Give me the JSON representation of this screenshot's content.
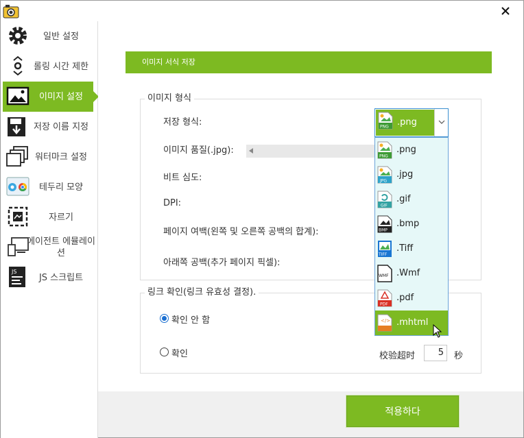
{
  "sidebar": {
    "items": [
      {
        "label": "일반 설정",
        "icon": "gear-icon"
      },
      {
        "label": "롤링 시간 제한",
        "icon": "scroll-icon"
      },
      {
        "label": "이미지 설정",
        "icon": "image-icon",
        "active": true
      },
      {
        "label": "저장 이름 지정",
        "icon": "save-icon"
      },
      {
        "label": "워터마크 설정",
        "icon": "watermark-icon"
      },
      {
        "label": "테두리 모양",
        "icon": "browser-icon"
      },
      {
        "label": "자르기",
        "icon": "crop-icon"
      },
      {
        "label": "에이전트 에뮬레이션",
        "icon": "devices-icon"
      },
      {
        "label": "JS 스크립트",
        "icon": "js-icon"
      }
    ]
  },
  "main": {
    "header": "이미지 서식 저장",
    "image_format_group": {
      "title": "이미지 형식",
      "save_format_label": "저장 형식:",
      "quality_label": "이미지 품질(.jpg):",
      "bit_depth_label": "비트 심도:",
      "dpi_label": "DPI:",
      "page_margin_label": "페이지 여백(왼쪽 및 오른쪽 공백의 합계):",
      "bottom_space_label": "아래쪽 공백(추가 페이지 픽셀):"
    },
    "format_combo": {
      "selected": ".png",
      "options": [
        ".png",
        ".jpg",
        ".gif",
        ".bmp",
        ".Tiff",
        ".Wmf",
        ".pdf",
        ".mhtml"
      ],
      "hovered": ".mhtml"
    },
    "link_group": {
      "title": "링크 확인(링크 유효성 결정).",
      "option_no_check": "확인 안 함",
      "option_check": "확인",
      "timeout_label": "校验超时",
      "timeout_value": "5",
      "timeout_unit": "秒"
    },
    "apply_label": "적용하다"
  },
  "colors": {
    "accent": "#7dba22",
    "radio": "#1a6fd1"
  }
}
